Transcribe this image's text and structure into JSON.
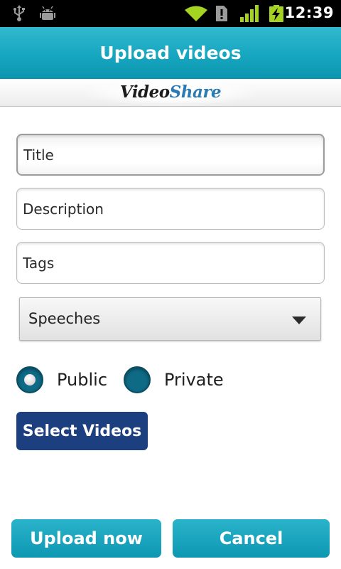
{
  "status_bar": {
    "time": "12:39",
    "icons": [
      "usb-icon",
      "debug-icon",
      "wifi-icon",
      "sim-card-icon",
      "signal-icon",
      "battery-charging-icon"
    ]
  },
  "header": {
    "title": "Upload videos"
  },
  "logo": {
    "part1": "Video",
    "part2": "Share"
  },
  "form": {
    "title_placeholder": "Title",
    "description_placeholder": "Description",
    "tags_placeholder": "Tags",
    "category_selected": "Speeches",
    "privacy": {
      "public_label": "Public",
      "private_label": "Private",
      "selected": "Public"
    },
    "select_videos_label": "Select Videos"
  },
  "actions": {
    "upload_label": "Upload now",
    "cancel_label": "Cancel"
  },
  "colors": {
    "title_bar": "#16a6c0",
    "action_buttons": "#16a3be",
    "select_button": "#1c3f7f",
    "radio": "#0e6a85",
    "status_bar": "#000000",
    "status_icons": "#a4d321"
  }
}
